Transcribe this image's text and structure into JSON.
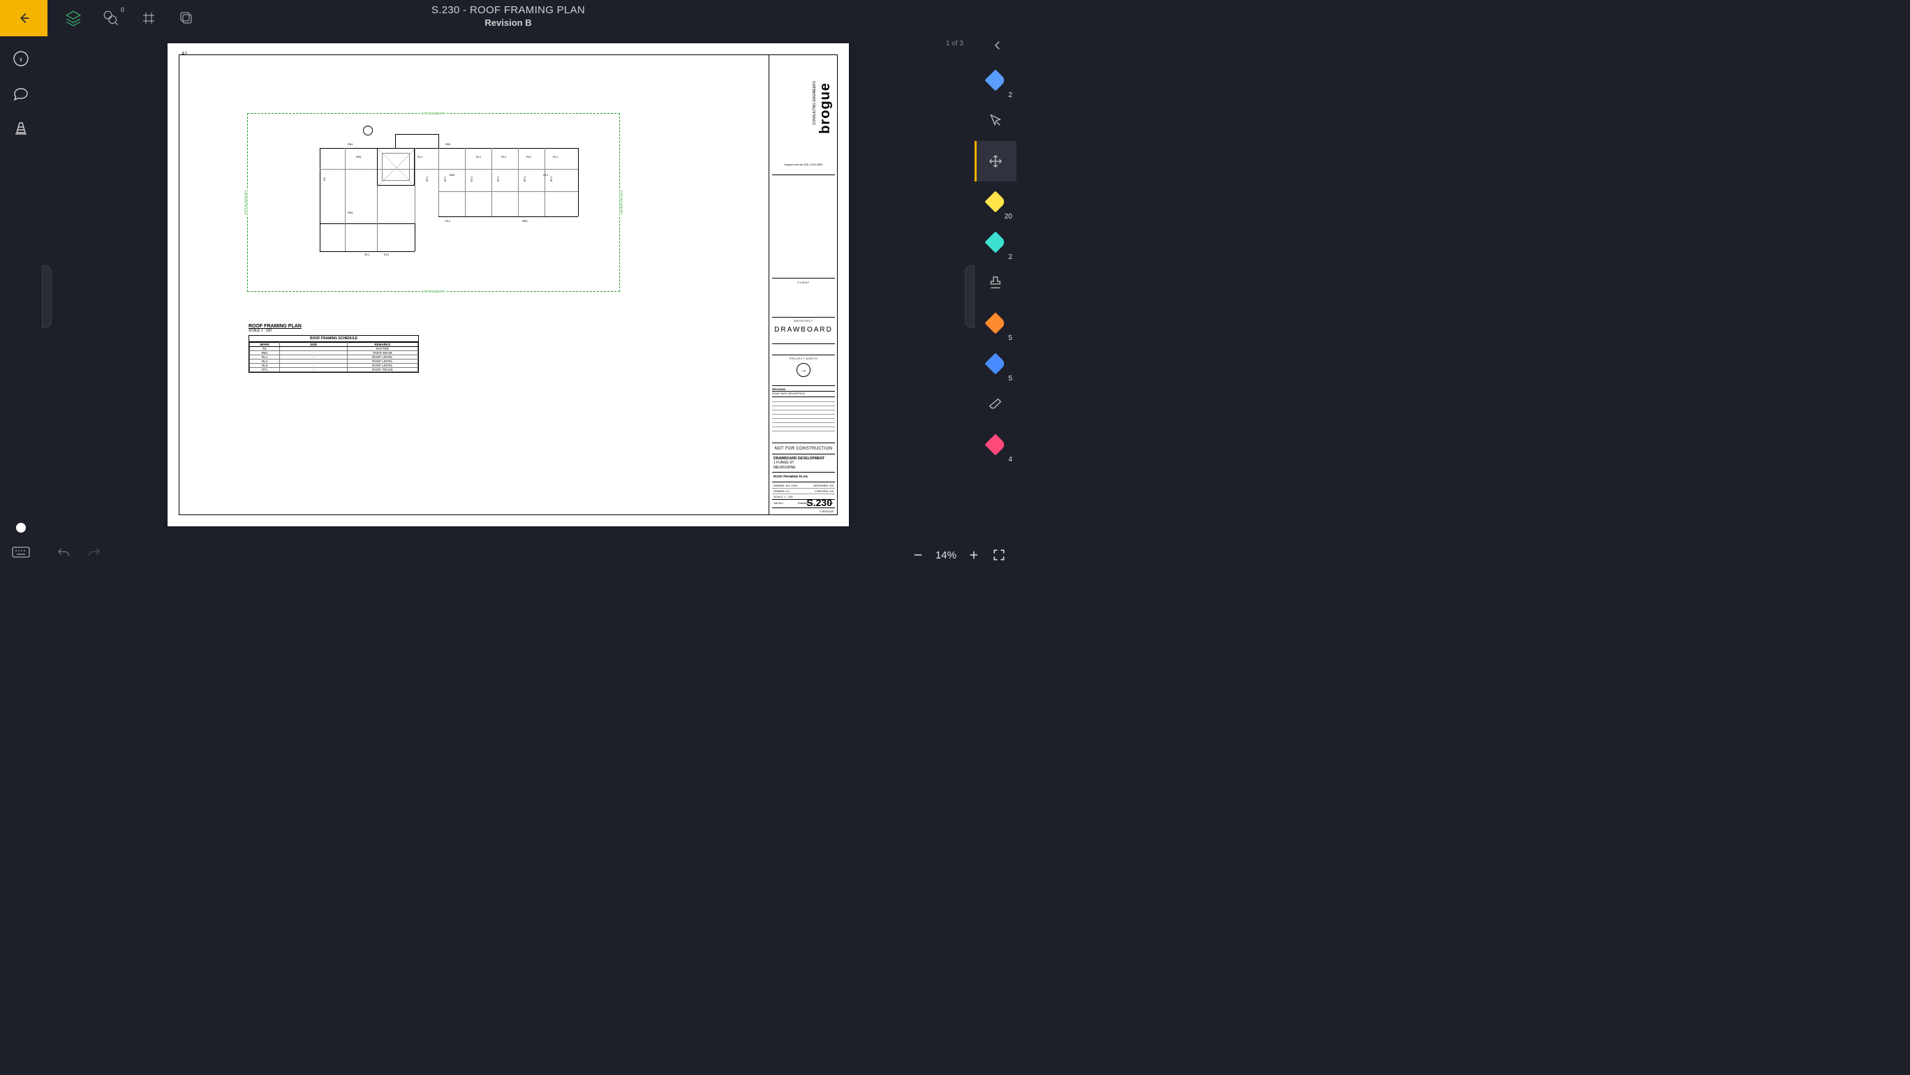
{
  "header": {
    "title": "S.230 - ROOF FRAMING PLAN",
    "revision": "Revision B"
  },
  "toolbar_top": {
    "search_badge": "0"
  },
  "page_indicator": "1 of 3",
  "zoom": {
    "level": "14%"
  },
  "right_tools": [
    {
      "id": "pen-blue-1",
      "type": "pen",
      "color": "blue1",
      "badge": "2"
    },
    {
      "id": "select",
      "type": "select",
      "badge": ""
    },
    {
      "id": "move",
      "type": "move",
      "badge": "",
      "active": true
    },
    {
      "id": "hl-yellow",
      "type": "pen",
      "color": "yellow",
      "badge": "20"
    },
    {
      "id": "hl-cyan",
      "type": "pen",
      "color": "cyan",
      "badge": "2"
    },
    {
      "id": "stamp",
      "type": "stamp",
      "badge": ""
    },
    {
      "id": "pen-orange",
      "type": "pen",
      "color": "orange",
      "badge": "5"
    },
    {
      "id": "pen-blue-2",
      "type": "pen",
      "color": "blue2",
      "badge": "5"
    },
    {
      "id": "eraser",
      "type": "eraser",
      "badge": ""
    },
    {
      "id": "pen-pink",
      "type": "pen",
      "color": "pink",
      "badge": "4"
    }
  ],
  "drawing": {
    "a_label": "A1",
    "site_boundary_label": "SITE BOUNDARY",
    "plan_title": "ROOF FRAMING PLAN",
    "plan_scale": "SCALE  1 : 100",
    "schedule": {
      "title": "ROOF FRAMING SCHEDULE",
      "columns": [
        "MARK",
        "SIZE",
        "REMARKS"
      ],
      "rows": [
        {
          "mark": "R1",
          "size": "-",
          "remarks": "RAFTER"
        },
        {
          "mark": "RB1",
          "size": "-",
          "remarks": "ROOF BEAM"
        },
        {
          "mark": "RL1",
          "size": "-",
          "remarks": "ROOF LINTEL"
        },
        {
          "mark": "RL2",
          "size": "-",
          "remarks": "ROOF LINTEL"
        },
        {
          "mark": "RL3",
          "size": "-",
          "remarks": "ROOF LINTEL"
        },
        {
          "mark": "RT1",
          "size": "-",
          "remarks": "ROOF TRUSS"
        }
      ]
    },
    "plan_labels": [
      "RB1",
      "RB1",
      "RB1",
      "RB1",
      "RL1",
      "RL1",
      "RL1",
      "RL2",
      "RL2",
      "RL1",
      "RL1",
      "RL3",
      "RT1",
      "RT1",
      "RT1",
      "RT1",
      "RT1",
      "RT1",
      "RB1",
      "RB1",
      "RL1",
      "R1"
    ],
    "titleblock": {
      "logo": "brogue",
      "logo_sub": "CONSULTING\nENGINEERS",
      "contact": "brogue.com.au\n(03) 1416 2892",
      "client_label": "CLIENT",
      "architect_label": "ARCHITECT",
      "architect": "DRAWBOARD",
      "north_label": "PROJECT NORTH",
      "revision_hdr": "REVISION",
      "revision_cols": "ISSUE    DATE    DESCRIPTION",
      "not_for": "NOT FOR CONSTRUCTION",
      "project": "DRAWBOARD DEVELOPMENT",
      "address1": "1 FUNGE ST",
      "address2": "MELBOURNE",
      "drawing_name": "ROOF FRAMING PLAN",
      "meta1_l": "DRAWN:   JUL 2019",
      "meta1_r": "DESIGNED:   DS",
      "meta2_l": "DRAWN:   CC",
      "meta2_r": "CHECKED:   KA",
      "meta3_l": "SCALE:   1 : 100",
      "meta3_r": "",
      "jobno_l": "Job No.:",
      "drawingno": "Drawing No.:",
      "rev_l": "Rev:",
      "sheet": "S.230",
      "copyright": "© BROGUE"
    }
  }
}
